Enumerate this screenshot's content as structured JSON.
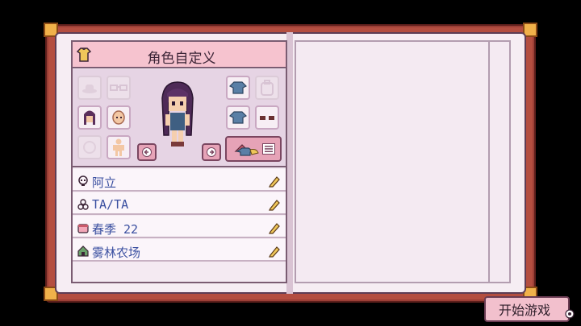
{
  "header": {
    "title": "角色自定义",
    "icon": "shirt-icon"
  },
  "rows": [
    {
      "icon": "skull-icon",
      "label": "阿立"
    },
    {
      "icon": "gender-icon",
      "label": "TA/TA"
    },
    {
      "icon": "calendar-icon",
      "label": "春季 22"
    },
    {
      "icon": "house-icon",
      "label": "雾林农场"
    }
  ],
  "start_button": {
    "label": "开始游戏",
    "key_hint": "gear-icon"
  },
  "colors": {
    "page": "#f6edf3",
    "header": "#f6c3cf",
    "button": "#e6a3b7",
    "text_blue": "#3a4fa0",
    "cover": "#b44e40"
  }
}
